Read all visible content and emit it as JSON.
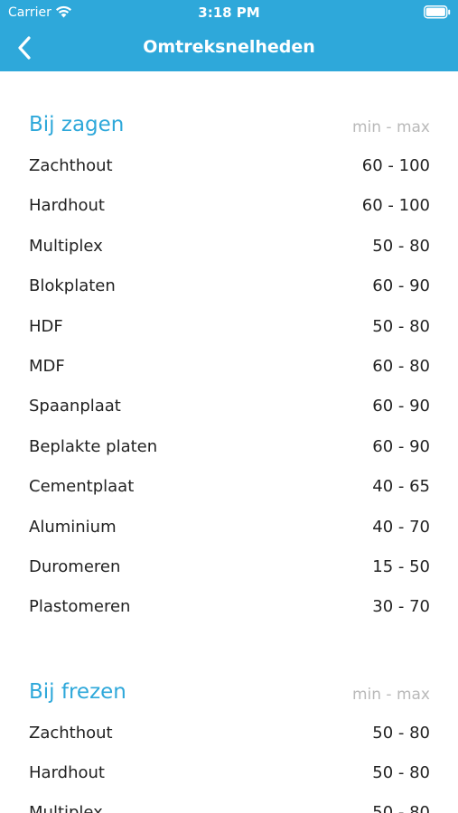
{
  "status": {
    "carrier": "Carrier",
    "time": "3:18 PM"
  },
  "nav": {
    "title": "Omtreksnelheden"
  },
  "sections": [
    {
      "title": "Bij zagen",
      "range_label": "min - max",
      "rows": [
        {
          "label": "Zachthout",
          "value": "60 - 100"
        },
        {
          "label": "Hardhout",
          "value": "60 - 100"
        },
        {
          "label": "Multiplex",
          "value": "50 - 80"
        },
        {
          "label": "Blokplaten",
          "value": "60 - 90"
        },
        {
          "label": "HDF",
          "value": "50 - 80"
        },
        {
          "label": "MDF",
          "value": "60 - 80"
        },
        {
          "label": "Spaanplaat",
          "value": "60 - 90"
        },
        {
          "label": "Beplakte platen",
          "value": "60 - 90"
        },
        {
          "label": "Cementplaat",
          "value": "40 - 65"
        },
        {
          "label": "Aluminium",
          "value": "40 - 70"
        },
        {
          "label": "Duromeren",
          "value": "15 - 50"
        },
        {
          "label": "Plastomeren",
          "value": "30 - 70"
        }
      ]
    },
    {
      "title": "Bij frezen",
      "range_label": "min - max",
      "rows": [
        {
          "label": "Zachthout",
          "value": "50 - 80"
        },
        {
          "label": "Hardhout",
          "value": "50 - 80"
        },
        {
          "label": "Multiplex",
          "value": "50 - 80"
        }
      ]
    }
  ]
}
